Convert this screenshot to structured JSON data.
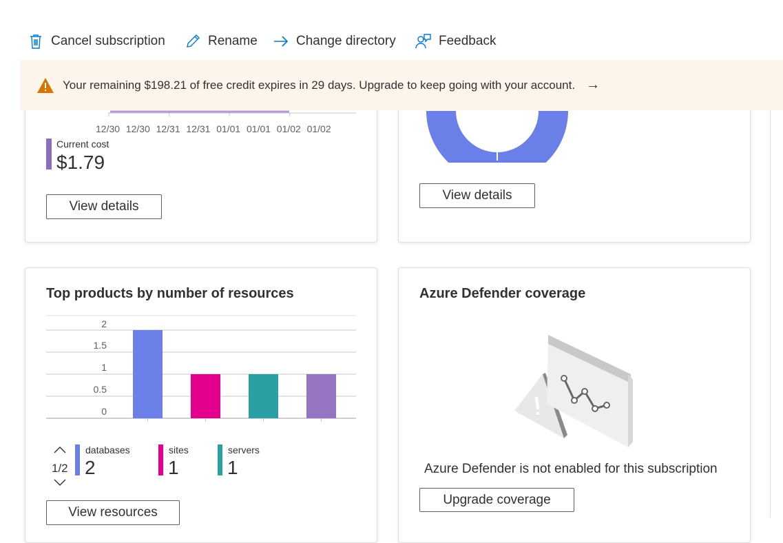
{
  "toolbar": {
    "cancel_label": "Cancel subscription",
    "rename_label": "Rename",
    "change_directory_label": "Change directory",
    "feedback_label": "Feedback"
  },
  "banner": {
    "message": "Your remaining $198.21 of free credit expires in 29 days. Upgrade to keep going with your account.",
    "arrow": "→"
  },
  "cost_card": {
    "x_ticks": [
      "12/30",
      "12/30",
      "12/31",
      "12/31",
      "01/01",
      "01/01",
      "01/02",
      "01/02"
    ],
    "current_cost_label": "Current cost",
    "current_cost_value": "$1.79",
    "view_details_label": "View details"
  },
  "donut_card": {
    "view_details_label": "View details"
  },
  "products_card": {
    "title": "Top products by number of resources",
    "pager_text": "1/2",
    "view_resources_label": "View resources",
    "legend": [
      {
        "label": "databases",
        "value": "2",
        "color": "#6b7fe8"
      },
      {
        "label": "sites",
        "value": "1",
        "color": "#e3008c"
      },
      {
        "label": "servers",
        "value": "1",
        "color": "#2aa0a4"
      }
    ]
  },
  "defender_card": {
    "title": "Azure Defender coverage",
    "message": "Azure Defender is not enabled for this subscription",
    "upgrade_label": "Upgrade coverage"
  },
  "chart_data": {
    "type": "bar",
    "categories": [
      "databases",
      "sites",
      "servers",
      ""
    ],
    "values": [
      2,
      1,
      1,
      1
    ],
    "colors": [
      "#6b7fe8",
      "#e3008c",
      "#2aa0a4",
      "#9575c2"
    ],
    "y_ticks": [
      "2",
      "1.5",
      "1",
      "0.5",
      "0"
    ],
    "ylim": [
      0,
      2
    ],
    "title": "Top products by number of resources"
  }
}
